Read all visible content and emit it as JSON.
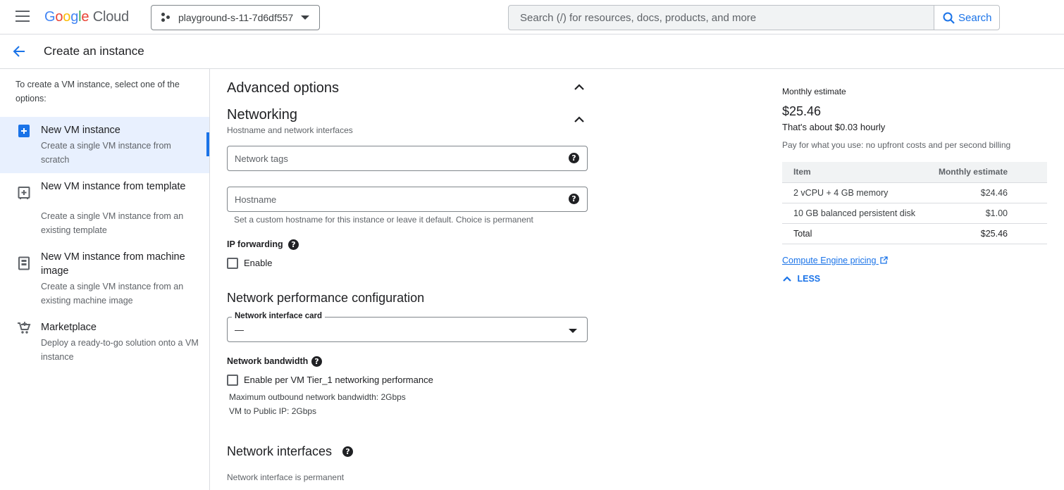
{
  "topbar": {
    "logo": {
      "g": "G",
      "o1": "o",
      "o2": "o",
      "g2": "g",
      "l": "l",
      "e": "e",
      "cloud": "Cloud"
    },
    "project_name": "playground-s-11-7d6df557",
    "search_placeholder": "Search (/) for resources, docs, products, and more",
    "search_button": "Search"
  },
  "subheader": {
    "title": "Create an instance"
  },
  "leftnav": {
    "intro": "To create a VM instance, select one of the options:",
    "options": [
      {
        "title": "New VM instance",
        "desc": "Create a single VM instance from scratch",
        "selected": true,
        "icon": "add-box-icon"
      },
      {
        "title": "New VM instance from template",
        "desc": "Create a single VM instance from an existing template",
        "icon": "template-icon"
      },
      {
        "title": "New VM instance from machine image",
        "desc": "Create a single VM instance from an existing machine image",
        "icon": "machine-image-icon"
      },
      {
        "title": "Marketplace",
        "desc": "Deploy a ready-to-go solution onto a VM instance",
        "icon": "cart-icon"
      }
    ]
  },
  "main": {
    "advanced_options": "Advanced options",
    "networking": "Networking",
    "networking_sub": "Hostname and network interfaces",
    "network_tags_placeholder": "Network tags",
    "hostname_placeholder": "Hostname",
    "hostname_hint": "Set a custom hostname for this instance or leave it default. Choice is permanent",
    "ip_forwarding": "IP forwarding",
    "ip_forwarding_enable": "Enable",
    "network_perf": "Network performance configuration",
    "nic_label": "Network interface card",
    "nic_value": "—",
    "bandwidth": "Network bandwidth",
    "tier1_label": "Enable per VM Tier_1 networking performance",
    "max_outbound": "Maximum outbound network bandwidth: 2Gbps",
    "vm_public": "VM to Public IP: 2Gbps",
    "net_interfaces": "Network interfaces",
    "net_interfaces_note": "Network interface is permanent",
    "help_glyph": "?"
  },
  "estimate": {
    "title": "Monthly estimate",
    "price": "$25.46",
    "hourly": "That's about $0.03 hourly",
    "note": "Pay for what you use: no upfront costs and per second billing",
    "col_item": "Item",
    "col_estimate": "Monthly estimate",
    "rows": [
      {
        "item": "2 vCPU + 4 GB memory",
        "cost": "$24.46"
      },
      {
        "item": "10 GB balanced persistent disk",
        "cost": "$1.00"
      }
    ],
    "total_label": "Total",
    "total_cost": "$25.46",
    "pricing_link": "Compute Engine pricing",
    "less": "LESS"
  },
  "colors": {
    "accent": "#1a73e8",
    "selected_bg": "#e8f0fe"
  }
}
